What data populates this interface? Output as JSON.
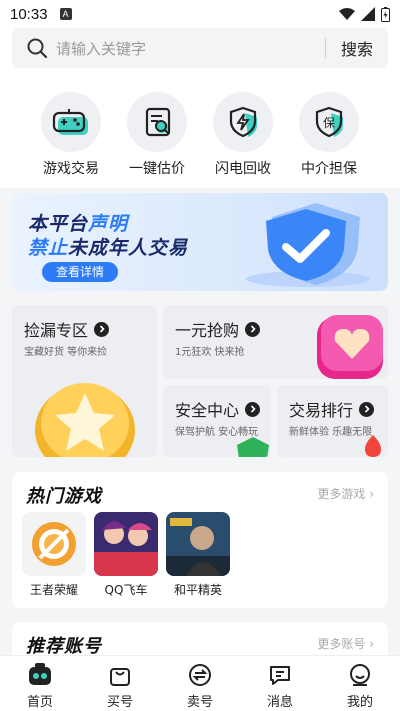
{
  "status_bar": {
    "time": "10:33",
    "badge": "A"
  },
  "search": {
    "placeholder": "请输入关键字",
    "button_label": "搜索"
  },
  "quick_actions": [
    {
      "label": "游戏交易",
      "icon": "gamepad-icon"
    },
    {
      "label": "一键估价",
      "icon": "appraise-icon"
    },
    {
      "label": "闪电回收",
      "icon": "lightning-shield-icon"
    },
    {
      "label": "中介担保",
      "icon": "guarantee-shield-icon"
    }
  ],
  "banner": {
    "line1_prefix": "本平台",
    "line1_highlight": "声明",
    "line2_highlight": "禁止",
    "line2_suffix": "未成年人交易",
    "button_label": "查看详情"
  },
  "zones": {
    "bargain": {
      "title": "捡漏专区",
      "subtitle": "宝藏好货 等你来捡"
    },
    "one_yuan": {
      "title": "一元抢购",
      "subtitle": "1元狂欢 快来抢"
    },
    "security": {
      "title": "安全中心",
      "subtitle": "保驾护航 安心畅玩"
    },
    "ranking": {
      "title": "交易排行",
      "subtitle": "新鲜体验 乐趣无限"
    }
  },
  "hot_games": {
    "title": "热门游戏",
    "more_label": "更多游戏",
    "games": [
      {
        "name": "王者荣耀"
      },
      {
        "name": "QQ飞车"
      },
      {
        "name": "和平精英"
      }
    ]
  },
  "recommended": {
    "title": "推荐账号",
    "more_label": "更多账号"
  },
  "tabs": [
    {
      "label": "首页",
      "icon": "home-icon",
      "active": true
    },
    {
      "label": "买号",
      "icon": "shopping-bag-icon",
      "active": false
    },
    {
      "label": "卖号",
      "icon": "sell-icon",
      "active": false
    },
    {
      "label": "消息",
      "icon": "message-icon",
      "active": false
    },
    {
      "label": "我的",
      "icon": "profile-icon",
      "active": false
    }
  ],
  "colors": {
    "accent": "#2d7cf6",
    "teal": "#22c1b5",
    "brand_dark": "#1a2a68"
  }
}
